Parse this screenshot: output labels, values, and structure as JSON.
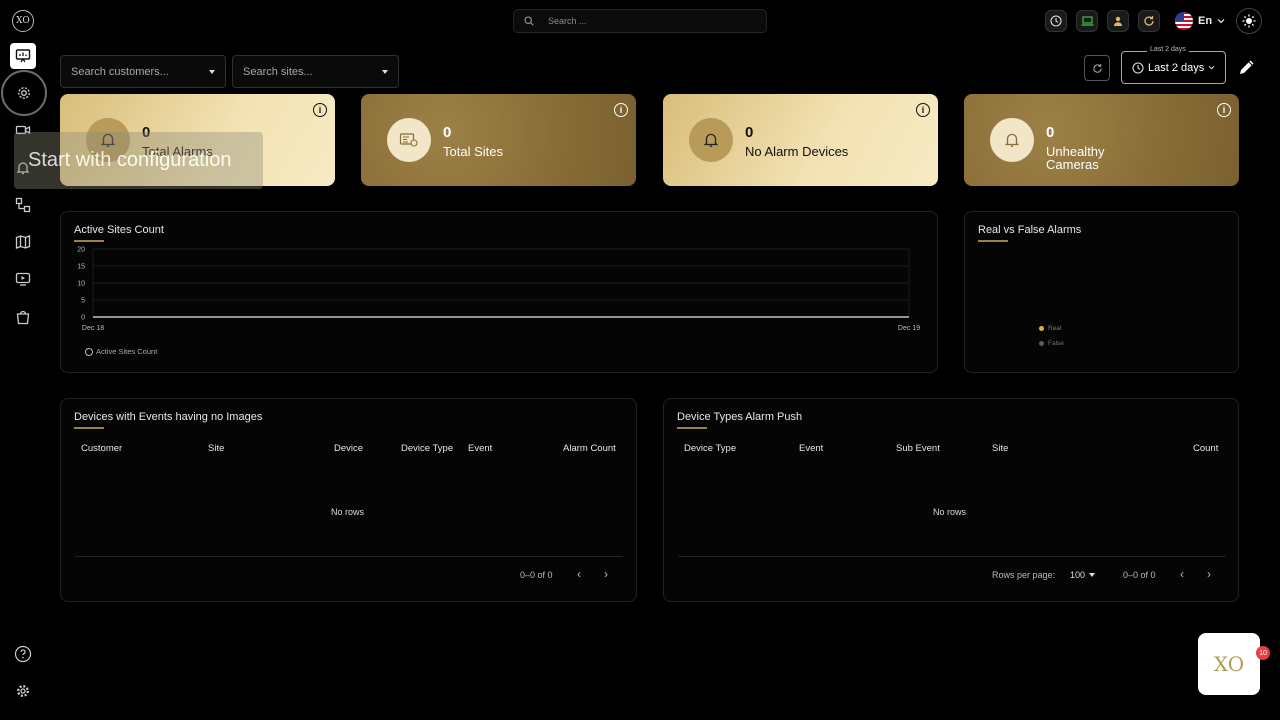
{
  "app": {
    "logo_text": "XO"
  },
  "topbar": {
    "search_placeholder": "Search ...",
    "language": "En"
  },
  "filters": {
    "customer_placeholder": "Search customers...",
    "site_placeholder": "Search sites...",
    "range_legend": "Last 2 days",
    "range_value": "Last 2 days"
  },
  "cards": [
    {
      "value": "0",
      "label": "Total Alarms"
    },
    {
      "value": "0",
      "label": "Total Sites"
    },
    {
      "value": "0",
      "label": "No Alarm Devices"
    },
    {
      "value": "0",
      "label": "Unhealthy Cameras"
    }
  ],
  "tooltip": {
    "text": "Start with configuration"
  },
  "active_sites": {
    "title": "Active Sites Count",
    "legend": "Active Sites Count"
  },
  "chart_data": {
    "type": "line",
    "title": "Active Sites Count",
    "x": [
      "Dec 18",
      "Dec 19"
    ],
    "series": [
      {
        "name": "Active Sites Count",
        "values": [
          0,
          0
        ]
      }
    ],
    "yticks": [
      20,
      15,
      10,
      5,
      0
    ],
    "ylim": [
      0,
      20
    ],
    "grid": true,
    "legend": "bottom-left"
  },
  "real_false": {
    "title": "Real vs False Alarms",
    "legend": [
      {
        "label": "Real",
        "color": "#e2b13c"
      },
      {
        "label": "False",
        "color": "#5b5b5b"
      }
    ]
  },
  "devices_no_images": {
    "title": "Devices with Events having no Images",
    "columns": [
      "Customer",
      "Site",
      "Device",
      "Device Type",
      "Event",
      "Alarm Count"
    ],
    "empty_text": "No rows",
    "pagination": "0–0 of 0"
  },
  "device_types_push": {
    "title": "Device Types Alarm Push",
    "columns": [
      "Device Type",
      "Event",
      "Sub Event",
      "Site",
      "Count"
    ],
    "empty_text": "No rows",
    "rows_per_page_label": "Rows per page:",
    "rows_per_page": "100",
    "pagination": "0–0 of 0"
  },
  "fab": {
    "text": "XO",
    "badge": "10"
  },
  "colors": {
    "gold": "#9c8147",
    "light_gold": "#f3e3b4"
  }
}
